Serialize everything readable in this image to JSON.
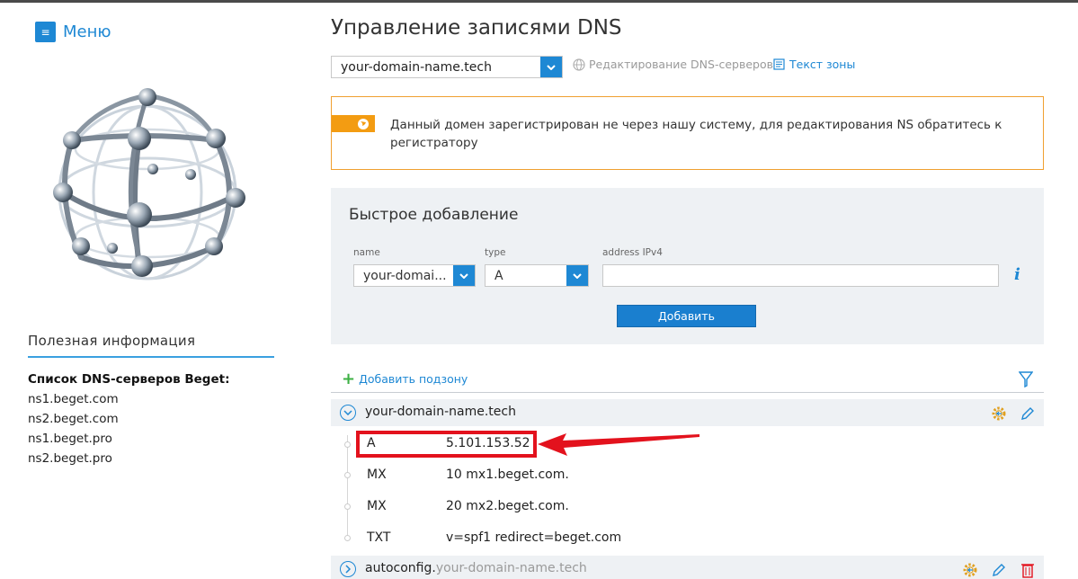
{
  "sidebar": {
    "menu_label": "Меню",
    "useful_title": "Полезная информация",
    "dns_list_title": "Список DNS-серверов Beget:",
    "ns_servers": [
      "ns1.beget.com",
      "ns2.beget.com",
      "ns1.beget.pro",
      "ns2.beget.pro"
    ]
  },
  "main": {
    "title": "Управление записями DNS",
    "domain_selected": "your-domain-name.tech",
    "edit_dns_link": "Редактирование DNS-серверов",
    "zone_text_link": "Текст зоны",
    "warning_text": "Данный домен зарегистрирован не через нашу систему, для редактирования NS обратитесь к регистратору"
  },
  "quick_add": {
    "title": "Быстрое добавление",
    "name_label": "name",
    "name_value": "your-domai...",
    "type_label": "type",
    "type_value": "A",
    "address_label": "address IPv4",
    "address_value": "",
    "add_button": "Добавить"
  },
  "records_section": {
    "add_subzone": "Добавить подзону",
    "zones": [
      {
        "name": "your-domain-name.tech",
        "prefix": "",
        "records": [
          {
            "type": "A",
            "value": "5.101.153.52"
          },
          {
            "type": "MX",
            "value": "10 mx1.beget.com."
          },
          {
            "type": "MX",
            "value": "20 mx2.beget.com."
          },
          {
            "type": "TXT",
            "value": "v=spf1 redirect=beget.com"
          }
        ]
      },
      {
        "name": "your-domain-name.tech",
        "prefix": "autoconfig."
      }
    ]
  },
  "colors": {
    "accent": "#1e88d4",
    "warning": "#f39c12",
    "highlight": "#e3121d",
    "panel_bg": "#eef1f4"
  }
}
